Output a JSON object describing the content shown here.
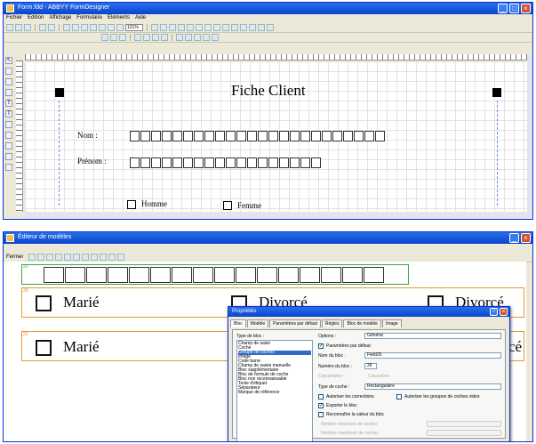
{
  "window1": {
    "title": "Form.fdd - ABBYY FormDesigner",
    "menu": [
      "Fichier",
      "Edition",
      "Affichage",
      "Formulaire",
      "Éléments",
      "Aide"
    ],
    "zoom": "121%",
    "form": {
      "title": "Fiche Client",
      "nom_label": "Nom :",
      "prenom_label": "Prénom :",
      "homme_label": "Homme",
      "femme_label": "Femme"
    }
  },
  "window2": {
    "title": "Éditeur de modèles",
    "toolbar_label": "Fermer",
    "group_labels": [
      "22",
      "28",
      "23"
    ],
    "row1": {
      "opt1": "Marié",
      "opt2": "Divorcé",
      "opt3": "Divorcé"
    },
    "row2": {
      "opt1": "Marié",
      "opt3": "cé"
    }
  },
  "dialog": {
    "title": "Propriétés",
    "tabs": [
      "Bloc",
      "Modèle",
      "Paramètres par défaut",
      "Règles",
      "Bloc de modèle",
      "Image"
    ],
    "active_tab": "Bloc",
    "list_label": "Type de bloc :",
    "list_items": [
      "Champ de saisir",
      "Coche",
      "Groupe de coches",
      "Image",
      "Code barre",
      "Champ de saisie manuelle",
      "Bloc supplémentaire",
      "Bloc de formule de coche",
      "Bloc non reconnaissable",
      "Texte d'étiquet",
      "Séparateur",
      "Marque de référence"
    ],
    "selected_index": 2,
    "options_label": "Options :",
    "options_value": "Général",
    "default_params": "Paramètres par défaut",
    "block_name_label": "Nom du bloc :",
    "block_name_value": "Field26",
    "block_number_label": "Numéro du bloc :",
    "block_number_value": "26",
    "coordinates_label": "Coordinates :",
    "characters_label": "Caractères",
    "check_type_label": "Type de coche :",
    "check_type_value": "Rectangulaire",
    "allow_corrections": "Autoriser les corrections",
    "allow_empty_groups": "Autoriser les groupes de coches vides",
    "export_block": "Exporter le bloc",
    "recognize_value": "Reconnaître la valeur du bloc",
    "min_checks_label": "Nombre minimum de coches",
    "max_checks_label": "Nombre maximum de coches"
  }
}
